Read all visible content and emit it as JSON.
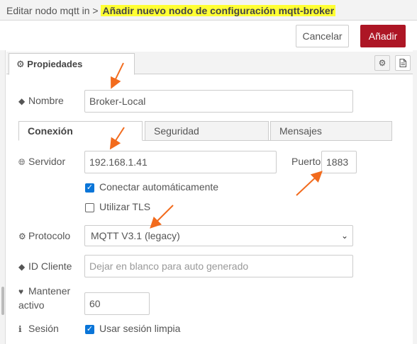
{
  "header": {
    "breadcrumb_prefix": "Editar nodo mqtt in >",
    "breadcrumb_current": "Añadir nuevo nodo de configuración mqtt-broker"
  },
  "toolbar": {
    "cancel_label": "Cancelar",
    "add_label": "Añadir"
  },
  "tabs": {
    "properties_label": "Propiedades"
  },
  "form": {
    "name_label": "Nombre",
    "name_value": "Broker-Local",
    "subtabs": [
      "Conexión",
      "Seguridad",
      "Mensajes"
    ],
    "server_label": "Servidor",
    "server_value": "192.168.1.41",
    "port_label": "Puerto",
    "port_value": "1883",
    "auto_connect_label": "Conectar automáticamente",
    "auto_connect_checked": true,
    "use_tls_label": "Utilizar TLS",
    "use_tls_checked": false,
    "protocol_label": "Protocolo",
    "protocol_value": "MQTT V3.1 (legacy)",
    "client_id_label": "ID Cliente",
    "client_id_placeholder": "Dejar en blanco para auto generado",
    "keepalive_label_line1": "Mantener",
    "keepalive_label_line2": "activo",
    "keepalive_value": "60",
    "session_label": "Sesión",
    "clean_session_label": "Usar sesión limpia",
    "clean_session_checked": true
  },
  "colors": {
    "accent": "#ad1625",
    "highlight": "#ffff33",
    "checkbox": "#0a75d8",
    "annotation_arrow": "#f26b1d"
  },
  "icons": {
    "properties_tab": "gear-icon",
    "name": "tag-icon",
    "server": "globe-icon",
    "protocol": "gear-icon",
    "client_id": "tag-icon",
    "keepalive": "heartbeat-icon",
    "session": "info-icon",
    "description_button": "document-icon"
  }
}
